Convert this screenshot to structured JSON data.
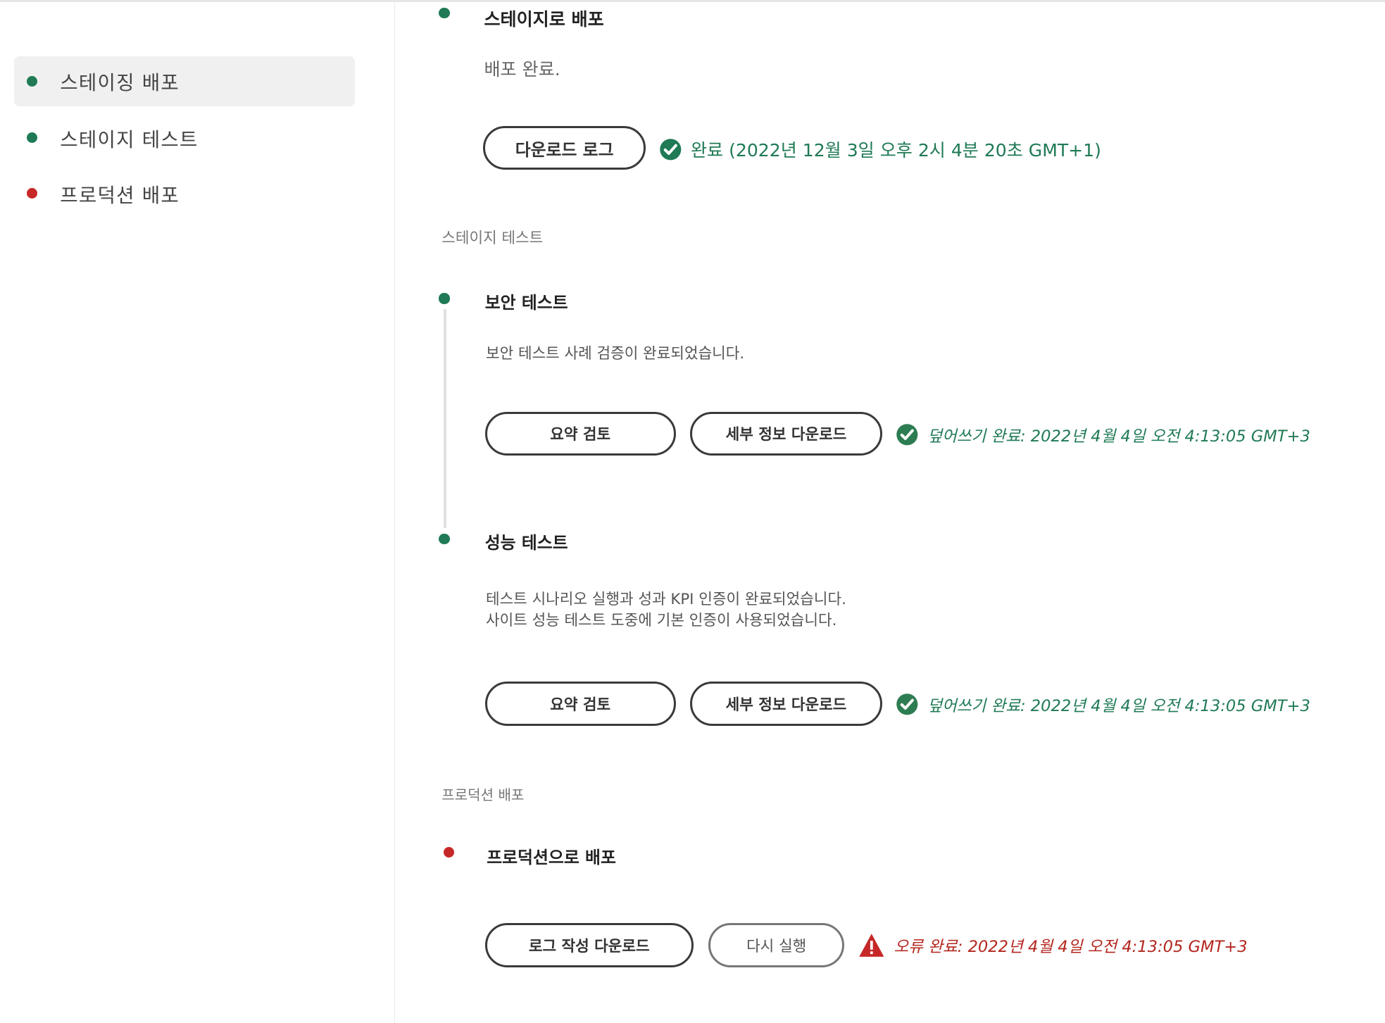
{
  "sidebar": {
    "items": [
      {
        "label": "스테이징 배포",
        "status": "success",
        "active": true
      },
      {
        "label": "스테이지 테스트",
        "status": "success",
        "active": false
      },
      {
        "label": "프로덕션 배포",
        "status": "error",
        "active": false
      }
    ]
  },
  "colors": {
    "success": "#1f7a55",
    "error": "#c62828"
  },
  "stage_deploy": {
    "title": "스테이지로 배포",
    "description": "배포 완료.",
    "download_log_label": "다운로드 로그",
    "status_text": "완료 (2022년 12월 3일 오후 2시 4분 20초 GMT+1)"
  },
  "stage_test": {
    "section_label": "스테이지 테스트",
    "security": {
      "title": "보안 테스트",
      "description": "보안 테스트 사례 검증이 완료되었습니다.",
      "review_label": "요약 검토",
      "download_label": "세부 정보 다운로드",
      "status_text": "덮어쓰기 완료: 2022년 4월 4일  오전 4:13:05 GMT+3"
    },
    "performance": {
      "title": "성능 테스트",
      "description_line1": "테스트 시나리오 실행과 성과 KPI 인증이 완료되었습니다.",
      "description_line2": "사이트 성능 테스트 도중에 기본 인증이 사용되었습니다.",
      "review_label": "요약 검토",
      "download_label": "세부 정보 다운로드",
      "status_text": "덮어쓰기 완료: 2022년 4월 4일  오전 4:13:05 GMT+3"
    }
  },
  "production": {
    "section_label": "프로덕션 배포",
    "title": "프로덕션으로 배포",
    "download_log_label": "로그 작성 다운로드",
    "rerun_label": "다시 실행",
    "status_text": "오류 완료: 2022년 4월 4일  오전 4:13:05 GMT+3"
  }
}
